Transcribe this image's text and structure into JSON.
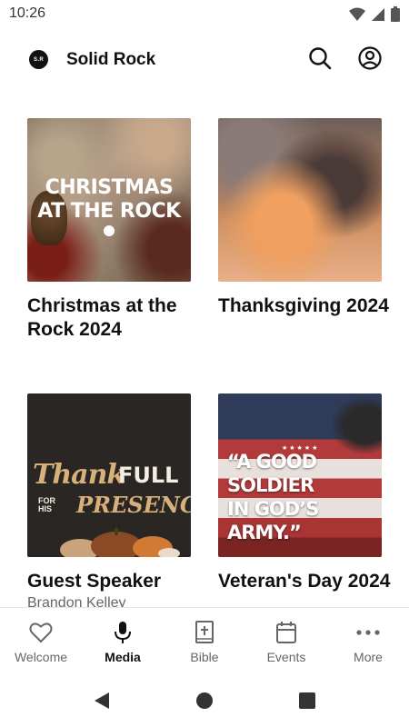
{
  "status": {
    "time": "10:26"
  },
  "header": {
    "logo_text": "S.R",
    "title": "Solid Rock"
  },
  "media": [
    {
      "title": "Christmas at the Rock 2024",
      "subtitle": "",
      "thumb_text": [
        "CHRISTMAS",
        "AT THE ROCK"
      ]
    },
    {
      "title": "Thanksgiving 2024",
      "subtitle": ""
    },
    {
      "title": "Guest Speaker",
      "subtitle": "Brandon Kelley",
      "thumb_text": {
        "thank": "Thank",
        "full": "FULL",
        "for": "FOR",
        "his": "HIS",
        "presence": "PRESENCE"
      }
    },
    {
      "title": "Veteran's Day 2024",
      "subtitle": "",
      "thumb_text": [
        "“A GOOD SOLDIER",
        "IN GOD’S ARMY.”"
      ]
    }
  ],
  "nav": [
    {
      "label": "Welcome",
      "icon": "heart-icon",
      "active": false
    },
    {
      "label": "Media",
      "icon": "microphone-icon",
      "active": true
    },
    {
      "label": "Bible",
      "icon": "bible-icon",
      "active": false
    },
    {
      "label": "Events",
      "icon": "calendar-icon",
      "active": false
    },
    {
      "label": "More",
      "icon": "more-icon",
      "active": false
    }
  ],
  "colors": {
    "active": "#111111",
    "inactive": "#666666",
    "divider": "#e6e6e6"
  }
}
